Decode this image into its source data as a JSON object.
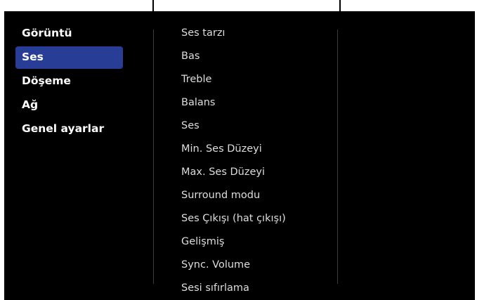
{
  "left_menu": {
    "items": [
      {
        "label": "Görüntü",
        "selected": false
      },
      {
        "label": "Ses",
        "selected": true
      },
      {
        "label": "Döşeme",
        "selected": false
      },
      {
        "label": "Ağ",
        "selected": false
      },
      {
        "label": "Genel ayarlar",
        "selected": false
      }
    ]
  },
  "right_menu": {
    "items": [
      {
        "label": "Ses tarzı"
      },
      {
        "label": "Bas"
      },
      {
        "label": "Treble"
      },
      {
        "label": "Balans"
      },
      {
        "label": "Ses"
      },
      {
        "label": "Min. Ses Düzeyi"
      },
      {
        "label": "Max. Ses Düzeyi"
      },
      {
        "label": "Surround modu"
      },
      {
        "label": "Ses Çıkışı (hat çıkışı)"
      },
      {
        "label": "Gelişmiş"
      },
      {
        "label": "Sync. Volume"
      },
      {
        "label": "Sesi sıfırlama"
      }
    ]
  },
  "colors": {
    "background": "#000000",
    "selected_highlight": "#283e96",
    "text": "#ffffff",
    "subtext": "#dedede"
  }
}
